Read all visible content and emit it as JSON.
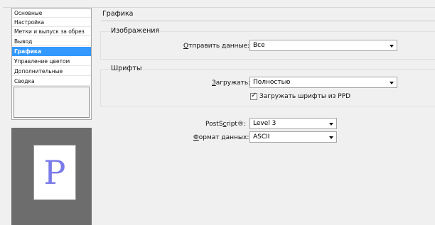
{
  "sidebar": {
    "items": [
      {
        "label": "Основные"
      },
      {
        "label": "Настройка"
      },
      {
        "label": "Метки и выпуск за обрез"
      },
      {
        "label": "Вывод"
      },
      {
        "label": "Графика"
      },
      {
        "label": "Управление цветом"
      },
      {
        "label": "Дополнительные"
      },
      {
        "label": "Сводка"
      }
    ],
    "selected_index": 4
  },
  "preview": {
    "glyph": "P",
    "glyph_color": "#7a7ae8"
  },
  "section": {
    "title": "Графика"
  },
  "images_group": {
    "label": "Изображения",
    "send_data_label": "Отправить данные:",
    "send_data_value": "Все"
  },
  "fonts_group": {
    "label": "Шрифты",
    "download_label": "Загружать:",
    "download_value": "Полностью",
    "ppd_checkbox_label": "Загружать шрифты из PPD",
    "ppd_checked": true
  },
  "postscript": {
    "label": "PostScript®:",
    "value": "Level 3"
  },
  "data_format": {
    "label": "Формат данных:",
    "value": "ASCII"
  },
  "colors": {
    "selection": "#3399ff",
    "preview_bg": "#6d6d6d",
    "page_bg": "#f0f0f0"
  }
}
